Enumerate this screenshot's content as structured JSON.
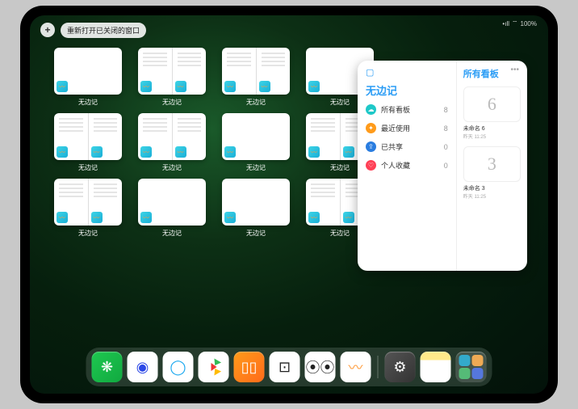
{
  "top_button_label": "重新打开已关闭的窗口",
  "status": {
    "signal": "•ıll",
    "wifi": "⌔",
    "battery": "100%"
  },
  "app_window_label": "无边记",
  "windows": [
    {
      "type": "plain"
    },
    {
      "type": "split"
    },
    {
      "type": "split"
    },
    {
      "type": "plain"
    },
    {
      "type": "split"
    },
    {
      "type": "split"
    },
    {
      "type": "plain"
    },
    {
      "type": "split"
    },
    {
      "type": "split"
    },
    {
      "type": "plain"
    },
    {
      "type": "plain"
    },
    {
      "type": "split"
    }
  ],
  "panel": {
    "title": "无边记",
    "right_title": "所有看板",
    "items": [
      {
        "icon": "ic1",
        "glyph": "☁",
        "label": "所有看板",
        "count": "8"
      },
      {
        "icon": "ic2",
        "glyph": "✦",
        "label": "最近使用",
        "count": "8"
      },
      {
        "icon": "ic3",
        "glyph": "⇪",
        "label": "已共享",
        "count": "0"
      },
      {
        "icon": "ic4",
        "glyph": "♡",
        "label": "个人收藏",
        "count": "0"
      }
    ],
    "cards": [
      {
        "sketch": "6",
        "title": "未命名 6",
        "sub": "昨天 11:25"
      },
      {
        "sketch": "3",
        "title": "未命名 3",
        "sub": "昨天 11:25"
      }
    ]
  },
  "dock": [
    {
      "name": "wechat-icon",
      "cls": "d1",
      "glyph": "❋"
    },
    {
      "name": "quark-hd-icon",
      "cls": "d2",
      "glyph": "◉"
    },
    {
      "name": "quark-icon",
      "cls": "d3",
      "glyph": "◯"
    },
    {
      "name": "iqiyi-icon",
      "cls": "d4",
      "glyph": ""
    },
    {
      "name": "books-icon",
      "cls": "d5",
      "glyph": "▯▯"
    },
    {
      "name": "dice-icon",
      "cls": "d6",
      "glyph": "⊡"
    },
    {
      "name": "handoff-icon",
      "cls": "d7",
      "glyph": "⦿⦿"
    },
    {
      "name": "freeform-icon",
      "cls": "d8",
      "glyph": "〰"
    },
    {
      "name": "settings-icon",
      "cls": "d9",
      "glyph": "⚙"
    },
    {
      "name": "notes-icon",
      "cls": "d10",
      "glyph": ""
    },
    {
      "name": "app-library-icon",
      "cls": "d11",
      "glyph": ""
    }
  ]
}
